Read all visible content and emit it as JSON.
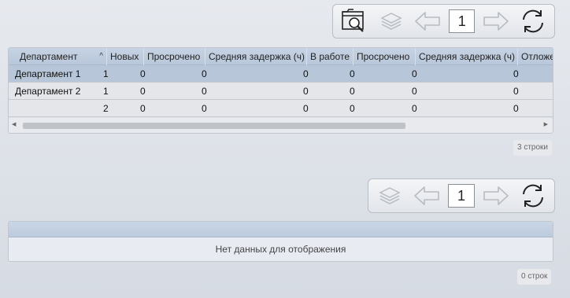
{
  "top_toolbar": {
    "page_number": "1"
  },
  "bottom_toolbar": {
    "page_number": "1"
  },
  "main_table": {
    "columns": [
      "Департамент",
      "Новых",
      "Просрочено",
      "Средняя задержка (ч)",
      "В работе",
      "Просрочено",
      "Средняя задержка (ч)",
      "Отложено"
    ],
    "sort_indicator": "^",
    "rows": [
      [
        "Департамент 1",
        "1",
        "0",
        "0",
        "0",
        "0",
        "0",
        "0"
      ],
      [
        "Департамент 2",
        "1",
        "0",
        "0",
        "0",
        "0",
        "0",
        "0"
      ],
      [
        "",
        "2",
        "0",
        "0",
        "0",
        "0",
        "0",
        "0"
      ]
    ],
    "row_count_label": "3 строки"
  },
  "second_table": {
    "empty_message": "Нет данных для отображения",
    "row_count_label": "0 строк"
  },
  "colors": {
    "header_bg": "#bccbdd",
    "selected_row_bg": "#b7c6d8",
    "row_bg": "#e4e6ea"
  }
}
